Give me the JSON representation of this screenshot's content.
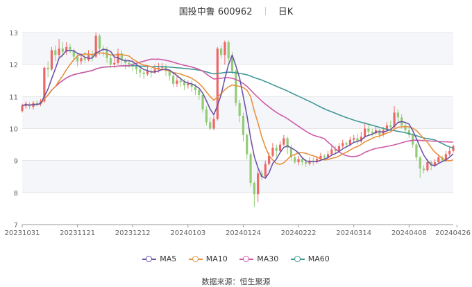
{
  "title": {
    "name": "国投中鲁",
    "code": "600962",
    "period": "日K"
  },
  "source": "数据来源：恒生聚源",
  "colors": {
    "up": "#ee6666",
    "down": "#91cc75",
    "MA5": "#6a55a6",
    "MA10": "#e8903c",
    "MA30": "#cf5aa8",
    "MA60": "#3f9896",
    "grid": "#e6e6e6",
    "band": "#f5f6fa",
    "axis": "#666666"
  },
  "chart_data": {
    "type": "candlestick",
    "y_ticks": [
      "7",
      "8",
      "9",
      "10",
      "11",
      "12",
      "13"
    ],
    "ylim": [
      7,
      13
    ],
    "x_ticks": [
      "20231031",
      "20231121",
      "20231212",
      "20240103",
      "20240124",
      "20240222",
      "20240314",
      "20240408",
      "20240426"
    ],
    "x_tick_index": [
      0,
      15,
      30,
      45,
      60,
      75,
      90,
      105,
      118
    ],
    "legend": [
      "MA5",
      "MA10",
      "MA30",
      "MA60"
    ],
    "candles": [
      [
        10.55,
        10.72,
        10.5,
        10.78
      ],
      [
        10.7,
        10.78,
        10.62,
        10.85
      ],
      [
        10.75,
        10.7,
        10.62,
        10.82
      ],
      [
        10.68,
        10.8,
        10.6,
        10.86
      ],
      [
        10.8,
        10.78,
        10.7,
        10.88
      ],
      [
        10.78,
        10.85,
        10.7,
        10.92
      ],
      [
        10.85,
        11.9,
        10.8,
        11.95
      ],
      [
        11.9,
        11.85,
        11.6,
        12.1
      ],
      [
        11.85,
        12.45,
        11.8,
        12.55
      ],
      [
        12.45,
        12.3,
        12.1,
        12.6
      ],
      [
        12.3,
        12.5,
        12.2,
        12.8
      ],
      [
        12.5,
        12.4,
        12.25,
        12.7
      ],
      [
        12.4,
        12.55,
        12.3,
        12.7
      ],
      [
        12.55,
        12.45,
        12.35,
        12.65
      ],
      [
        12.45,
        12.25,
        12.1,
        12.5
      ],
      [
        12.25,
        12.1,
        11.95,
        12.35
      ],
      [
        12.1,
        12.2,
        12.0,
        12.35
      ],
      [
        12.2,
        12.15,
        12.05,
        12.4
      ],
      [
        12.15,
        12.3,
        12.1,
        12.45
      ],
      [
        12.3,
        12.25,
        12.1,
        12.45
      ],
      [
        12.25,
        12.9,
        12.2,
        13.0
      ],
      [
        12.9,
        12.5,
        12.3,
        12.95
      ],
      [
        12.5,
        12.45,
        12.25,
        12.6
      ],
      [
        12.45,
        12.2,
        12.05,
        12.55
      ],
      [
        12.2,
        12.0,
        11.9,
        12.3
      ],
      [
        12.0,
        12.05,
        11.9,
        12.25
      ],
      [
        12.05,
        12.35,
        12.0,
        12.5
      ],
      [
        12.35,
        12.15,
        12.0,
        12.45
      ],
      [
        12.15,
        12.05,
        11.85,
        12.2
      ],
      [
        12.05,
        12.0,
        11.9,
        12.15
      ],
      [
        12.0,
        11.95,
        11.8,
        12.1
      ],
      [
        11.95,
        11.85,
        11.7,
        12.05
      ],
      [
        11.85,
        11.75,
        11.6,
        11.95
      ],
      [
        11.75,
        11.7,
        11.55,
        11.85
      ],
      [
        11.7,
        11.8,
        11.65,
        11.95
      ],
      [
        11.8,
        11.75,
        11.6,
        11.9
      ],
      [
        11.75,
        11.85,
        11.7,
        12.0
      ],
      [
        11.85,
        11.9,
        11.75,
        12.05
      ],
      [
        11.9,
        11.95,
        11.8,
        12.05
      ],
      [
        11.95,
        11.8,
        11.65,
        12.0
      ],
      [
        11.8,
        11.65,
        11.5,
        11.85
      ],
      [
        11.65,
        11.4,
        11.3,
        11.75
      ],
      [
        11.4,
        11.5,
        11.3,
        11.65
      ],
      [
        11.5,
        11.45,
        11.3,
        11.6
      ],
      [
        11.45,
        11.35,
        11.2,
        11.55
      ],
      [
        11.35,
        11.4,
        11.25,
        11.5
      ],
      [
        11.4,
        11.3,
        11.15,
        11.5
      ],
      [
        11.3,
        11.2,
        11.05,
        11.4
      ],
      [
        11.2,
        11.05,
        10.9,
        11.25
      ],
      [
        11.05,
        10.6,
        10.5,
        11.1
      ],
      [
        10.6,
        10.2,
        10.1,
        10.7
      ],
      [
        10.2,
        10.0,
        9.95,
        10.35
      ],
      [
        10.0,
        10.3,
        9.95,
        10.4
      ],
      [
        10.3,
        12.5,
        10.25,
        12.55
      ],
      [
        12.5,
        12.3,
        12.2,
        12.6
      ],
      [
        12.3,
        12.7,
        12.0,
        12.75
      ],
      [
        12.7,
        12.2,
        12.1,
        12.75
      ],
      [
        12.2,
        11.8,
        11.7,
        12.4
      ],
      [
        11.8,
        10.8,
        10.7,
        11.85
      ],
      [
        10.8,
        10.4,
        10.2,
        10.9
      ],
      [
        10.4,
        9.8,
        9.6,
        10.5
      ],
      [
        9.8,
        9.2,
        9.05,
        9.85
      ],
      [
        9.2,
        8.3,
        8.2,
        9.25
      ],
      [
        8.3,
        7.95,
        7.55,
        8.35
      ],
      [
        7.95,
        8.6,
        7.7,
        8.7
      ],
      [
        8.6,
        8.5,
        8.4,
        8.7
      ],
      [
        8.5,
        8.9,
        8.45,
        9.0
      ],
      [
        8.9,
        9.15,
        8.85,
        9.25
      ],
      [
        9.15,
        9.4,
        9.1,
        9.55
      ],
      [
        9.4,
        9.3,
        9.1,
        9.5
      ],
      [
        9.3,
        9.5,
        9.25,
        9.6
      ],
      [
        9.5,
        9.7,
        9.45,
        9.8
      ],
      [
        9.7,
        9.4,
        9.2,
        9.75
      ],
      [
        9.4,
        9.1,
        9.0,
        9.5
      ],
      [
        9.1,
        8.95,
        8.9,
        9.2
      ],
      [
        8.95,
        9.05,
        8.85,
        9.15
      ],
      [
        9.05,
        8.95,
        8.85,
        9.1
      ],
      [
        8.95,
        8.9,
        8.8,
        9.05
      ],
      [
        8.9,
        9.0,
        8.85,
        9.1
      ],
      [
        9.0,
        8.95,
        8.85,
        9.1
      ],
      [
        8.95,
        9.05,
        8.9,
        9.15
      ],
      [
        9.05,
        9.15,
        9.0,
        9.25
      ],
      [
        9.15,
        9.1,
        9.0,
        9.2
      ],
      [
        9.1,
        9.2,
        9.05,
        9.3
      ],
      [
        9.2,
        9.35,
        9.15,
        9.45
      ],
      [
        9.35,
        9.3,
        9.2,
        9.45
      ],
      [
        9.3,
        9.45,
        9.25,
        9.55
      ],
      [
        9.45,
        9.55,
        9.4,
        9.65
      ],
      [
        9.55,
        9.5,
        9.4,
        9.6
      ],
      [
        9.5,
        9.65,
        9.45,
        9.75
      ],
      [
        9.65,
        9.7,
        9.55,
        9.8
      ],
      [
        9.7,
        9.6,
        9.5,
        9.85
      ],
      [
        9.6,
        9.75,
        9.55,
        9.9
      ],
      [
        9.75,
        10.0,
        9.7,
        10.2
      ],
      [
        10.0,
        9.9,
        9.8,
        10.1
      ],
      [
        9.9,
        9.85,
        9.75,
        10.0
      ],
      [
        9.85,
        9.95,
        9.8,
        10.05
      ],
      [
        9.95,
        9.8,
        9.7,
        10.0
      ],
      [
        9.8,
        9.95,
        9.75,
        10.05
      ],
      [
        9.95,
        10.1,
        9.9,
        10.2
      ],
      [
        10.1,
        10.05,
        9.95,
        10.25
      ],
      [
        10.05,
        10.5,
        10.0,
        10.7
      ],
      [
        10.5,
        10.35,
        10.2,
        10.6
      ],
      [
        10.35,
        10.1,
        10.0,
        10.45
      ],
      [
        10.1,
        9.95,
        9.85,
        10.2
      ],
      [
        9.95,
        9.8,
        9.7,
        10.05
      ],
      [
        9.8,
        9.5,
        9.4,
        9.85
      ],
      [
        9.5,
        9.1,
        9.0,
        9.55
      ],
      [
        9.1,
        8.75,
        8.45,
        9.15
      ],
      [
        8.75,
        8.7,
        8.6,
        8.85
      ],
      [
        8.7,
        8.95,
        8.65,
        9.05
      ],
      [
        8.95,
        8.85,
        8.7,
        9.0
      ],
      [
        8.85,
        8.95,
        8.8,
        9.05
      ],
      [
        8.95,
        9.1,
        8.9,
        9.2
      ],
      [
        9.1,
        9.0,
        8.95,
        9.15
      ],
      [
        9.0,
        9.2,
        8.95,
        9.3
      ],
      [
        9.2,
        9.3,
        9.15,
        9.4
      ],
      [
        9.3,
        9.45,
        9.25,
        9.5
      ]
    ]
  }
}
